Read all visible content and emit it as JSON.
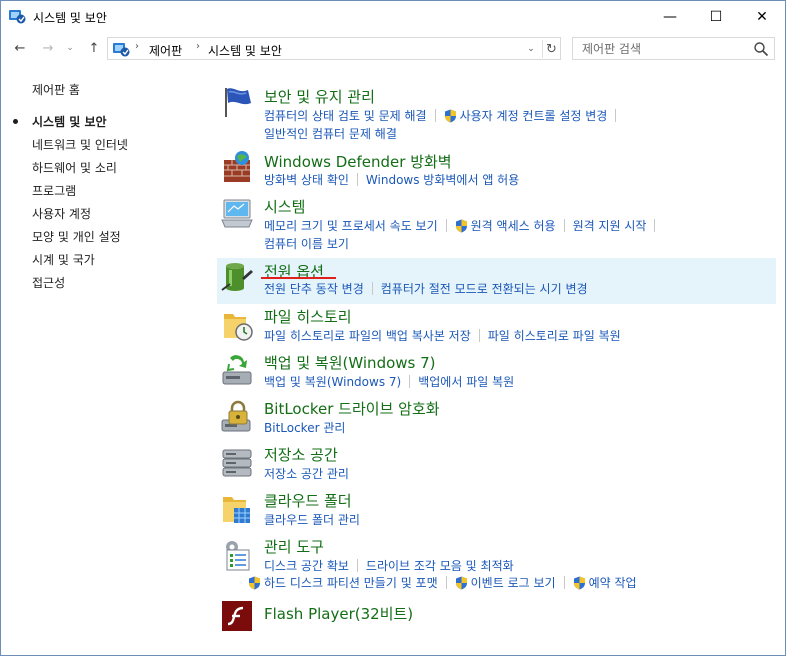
{
  "window": {
    "title": "시스템 및 보안",
    "minimize": "—",
    "maximize": "☐",
    "close": "✕"
  },
  "nav": {
    "back": "←",
    "forward": "→",
    "recent": "⌄",
    "up": "↑",
    "address_sep": "›",
    "breadcrumb": [
      "제어판",
      "시스템 및 보안"
    ],
    "dropdown": "⌄",
    "refresh": "↻",
    "search_placeholder": "제어판 검색"
  },
  "sidebar": {
    "items": [
      {
        "label": "제어판 홈",
        "active": false
      },
      {
        "label": "시스템 및 보안",
        "active": true
      },
      {
        "label": "네트워크 및 인터넷",
        "active": false
      },
      {
        "label": "하드웨어 및 소리",
        "active": false
      },
      {
        "label": "프로그램",
        "active": false
      },
      {
        "label": "사용자 계정",
        "active": false
      },
      {
        "label": "모양 및 개인 설정",
        "active": false
      },
      {
        "label": "시계 및 국가",
        "active": false
      },
      {
        "label": "접근성",
        "active": false
      }
    ]
  },
  "categories": [
    {
      "title": "보안 및 유지 관리",
      "icon": "flag-icon",
      "link_rows": [
        [
          {
            "text": "컴퓨터의 상태 검토 및 문제 해결",
            "shield": false
          },
          {
            "text": "사용자 계정 컨트롤 설정 변경",
            "shield": true
          }
        ],
        [
          {
            "text": "일반적인 컴퓨터 문제 해결",
            "shield": false
          }
        ]
      ]
    },
    {
      "title": "Windows Defender 방화벽",
      "icon": "firewall-icon",
      "link_rows": [
        [
          {
            "text": "방화벽 상태 확인",
            "shield": false
          },
          {
            "text": "Windows 방화벽에서 앱 허용",
            "shield": false
          }
        ]
      ]
    },
    {
      "title": "시스템",
      "icon": "computer-icon",
      "link_rows": [
        [
          {
            "text": "메모리 크기 및 프로세서 속도 보기",
            "shield": false
          },
          {
            "text": "원격 액세스 허용",
            "shield": true
          },
          {
            "text": "원격 지원 시작",
            "shield": false
          }
        ],
        [
          {
            "text": "컴퓨터 이름 보기",
            "shield": false
          }
        ]
      ]
    },
    {
      "title": "전원 옵션",
      "icon": "battery-icon",
      "highlighted": true,
      "link_rows": [
        [
          {
            "text": "전원 단추 동작 변경",
            "shield": false
          },
          {
            "text": "컴퓨터가 절전 모드로 전환되는 시기 변경",
            "shield": false
          }
        ]
      ]
    },
    {
      "title": "파일 히스토리",
      "icon": "file-history-icon",
      "link_rows": [
        [
          {
            "text": "파일 히스토리로 파일의 백업 복사본 저장",
            "shield": false
          },
          {
            "text": "파일 히스토리로 파일 복원",
            "shield": false
          }
        ]
      ]
    },
    {
      "title": "백업 및 복원(Windows 7)",
      "icon": "backup-icon",
      "link_rows": [
        [
          {
            "text": "백업 및 복원(Windows 7)",
            "shield": false
          },
          {
            "text": "백업에서 파일 복원",
            "shield": false
          }
        ]
      ]
    },
    {
      "title": "BitLocker 드라이브 암호화",
      "icon": "bitlocker-icon",
      "link_rows": [
        [
          {
            "text": "BitLocker 관리",
            "shield": false
          }
        ]
      ]
    },
    {
      "title": "저장소 공간",
      "icon": "storage-icon",
      "link_rows": [
        [
          {
            "text": "저장소 공간 관리",
            "shield": false
          }
        ]
      ]
    },
    {
      "title": "클라우드 폴더",
      "icon": "cloud-folder-icon",
      "link_rows": [
        [
          {
            "text": "클라우드 폴더 관리",
            "shield": false
          }
        ]
      ]
    },
    {
      "title": "관리 도구",
      "icon": "admin-tools-icon",
      "link_rows": [
        [
          {
            "text": "디스크 공간 확보",
            "shield": false
          },
          {
            "text": "드라이브 조각 모음 및 최적화",
            "shield": false
          }
        ],
        [
          {
            "text": "하드 디스크 파티션 만들기 및 포맷",
            "shield": true
          },
          {
            "text": "이벤트 로그 보기",
            "shield": true
          },
          {
            "text": "예약 작업",
            "shield": true
          }
        ]
      ]
    },
    {
      "title": "Flash Player(32비트)",
      "icon": "flash-icon",
      "link_rows": []
    }
  ],
  "colors": {
    "title_green": "#136e16",
    "link_blue": "#1b58b8",
    "highlight": "#e5f3fb",
    "annotation_red": "#e0201b"
  }
}
